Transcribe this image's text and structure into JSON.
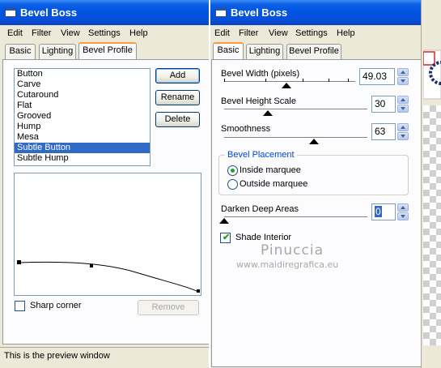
{
  "left_window": {
    "title": "Bevel Boss",
    "menu": [
      "Edit",
      "Filter",
      "View",
      "Settings",
      "Help"
    ],
    "tabs": [
      "Basic",
      "Lighting",
      "Bevel Profile"
    ],
    "active_tab": "Bevel Profile",
    "profiles": [
      "Button",
      "Carve",
      "Cutaround",
      "Flat",
      "Grooved",
      "Hump",
      "Mesa",
      "Subtle Button",
      "Subtle Hump"
    ],
    "selected_profile": "Subtle Button",
    "buttons": {
      "add": "Add",
      "rename": "Rename",
      "delete": "Delete",
      "remove": "Remove"
    },
    "sharp_corner_label": "Sharp corner",
    "sharp_corner_checked": false,
    "status_text": "This is the preview window"
  },
  "right_window": {
    "title": "Bevel Boss",
    "menu": [
      "Edit",
      "Filter",
      "View",
      "Settings",
      "Help"
    ],
    "tabs": [
      "Basic",
      "Lighting",
      "Bevel Profile"
    ],
    "active_tab": "Basic",
    "bevel_width": {
      "label": "Bevel Width (pixels)",
      "value": "49.03"
    },
    "bevel_height_scale": {
      "label": "Bevel Height Scale",
      "value": "30"
    },
    "smoothness": {
      "label": "Smoothness",
      "value": "63"
    },
    "bevel_placement": {
      "label": "Bevel Placement",
      "options": [
        "Inside marquee",
        "Outside marquee"
      ],
      "selected": "Inside marquee"
    },
    "darken_deep_areas": {
      "label": "Darken Deep Areas",
      "value": "0"
    },
    "shade_interior": {
      "label": "Shade Interior",
      "checked": true
    }
  },
  "watermark": {
    "name": "Pinuccia",
    "url": "www.maidiregrafica.eu"
  },
  "colors": {
    "title_bar": "#0054e3",
    "selection": "#316ac5",
    "group_label": "#0046d5",
    "tab_accent": "#ff9a3c"
  },
  "icons": [
    "window-icon",
    "spin-up-icon",
    "spin-down-icon",
    "checkmark-icon",
    "radio-dot-icon",
    "slider-thumb-icon",
    "curve-point-icon"
  ]
}
